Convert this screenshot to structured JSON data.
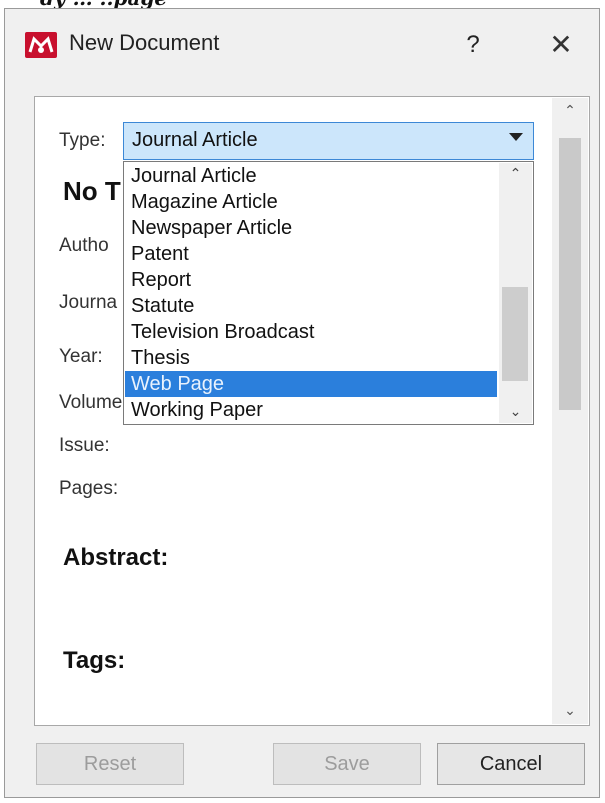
{
  "caption": "dy … ..page",
  "dialog": {
    "title": "New Document",
    "help_label": "?",
    "close_label": "✕",
    "app_icon": "mendeley-logo-icon"
  },
  "form": {
    "type_label": "Type:",
    "type_value": "Journal Article",
    "doc_title_fragment": "No T",
    "labels": {
      "authors": "Autho",
      "journal": "Journa",
      "year": "Year:",
      "volume": "Volume",
      "issue": "Issue:",
      "pages": "Pages:"
    },
    "abstract_heading": "Abstract:",
    "tags_heading": "Tags:"
  },
  "dropdown": {
    "options": [
      "Journal Article",
      "Magazine Article",
      "Newspaper Article",
      "Patent",
      "Report",
      "Statute",
      "Television Broadcast",
      "Thesis",
      "Web Page",
      "Working Paper"
    ],
    "selected": "Web Page"
  },
  "buttons": {
    "reset": "Reset",
    "save": "Save",
    "cancel": "Cancel"
  },
  "colors": {
    "accent_highlight": "#2b7fdc",
    "app_icon_red": "#c8102e"
  }
}
